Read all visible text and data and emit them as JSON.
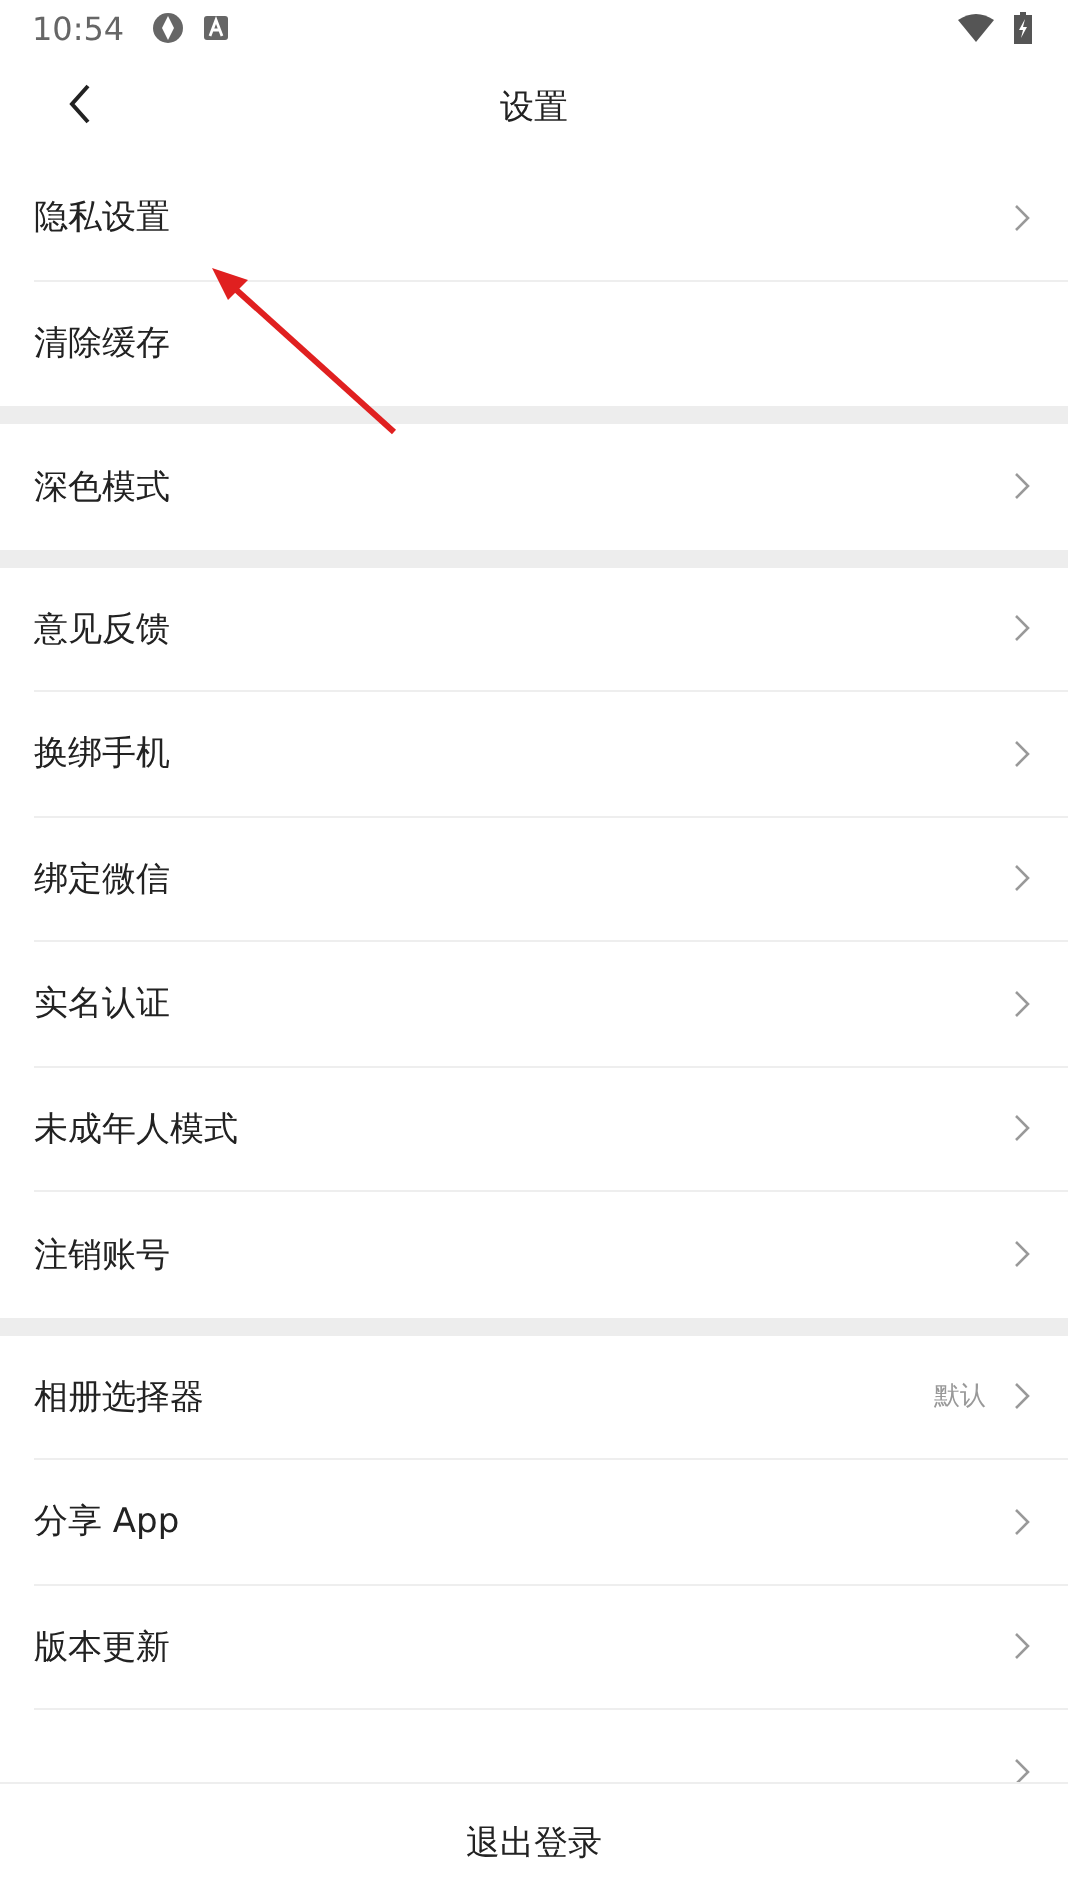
{
  "status_bar": {
    "time": "10:54"
  },
  "header": {
    "title": "设置"
  },
  "sections": [
    {
      "items": [
        {
          "title": "隐私设置",
          "chevron": true
        },
        {
          "title": "清除缓存",
          "chevron": false
        }
      ]
    },
    {
      "items": [
        {
          "title": "深色模式",
          "chevron": true
        }
      ]
    },
    {
      "items": [
        {
          "title": "意见反馈",
          "chevron": true
        },
        {
          "title": "换绑手机",
          "chevron": true
        },
        {
          "title": "绑定微信",
          "chevron": true
        },
        {
          "title": "实名认证",
          "chevron": true
        },
        {
          "title": "未成年人模式",
          "chevron": true
        },
        {
          "title": "注销账号",
          "chevron": true
        }
      ]
    },
    {
      "items": [
        {
          "title": "相册选择器",
          "value": "默认",
          "chevron": true
        },
        {
          "title": "分享 App",
          "chevron": true
        },
        {
          "title": "版本更新",
          "chevron": true
        },
        {
          "chevron": true
        }
      ]
    }
  ],
  "logout_button": "退出登录"
}
